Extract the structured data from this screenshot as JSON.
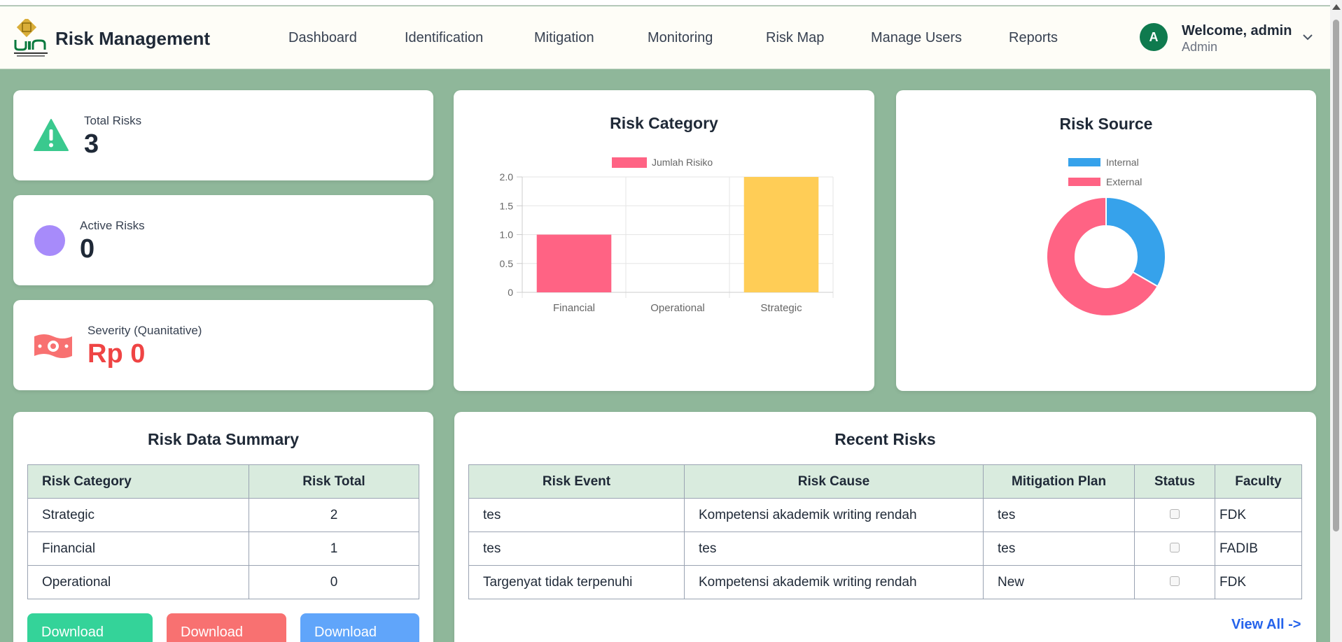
{
  "app": {
    "title": "Risk Management"
  },
  "nav": {
    "items": [
      {
        "label": "Dashboard"
      },
      {
        "label": "Identification"
      },
      {
        "label": "Mitigation"
      },
      {
        "label": "Monitoring"
      },
      {
        "label": "Risk Map"
      },
      {
        "label": "Manage Users"
      },
      {
        "label": "Reports"
      }
    ]
  },
  "user": {
    "avatar_letter": "A",
    "welcome": "Welcome, admin",
    "role": "Admin"
  },
  "stats": {
    "total": {
      "label": "Total Risks",
      "value": "3",
      "icon": "warning-icon"
    },
    "active": {
      "label": "Active Risks",
      "value": "0",
      "icon": "circle-icon"
    },
    "severity": {
      "label": "Severity (Quanitative)",
      "value": "Rp 0",
      "icon": "money-icon"
    }
  },
  "colors": {
    "accent_green": "#3ac98e",
    "purple": "#a78bfa",
    "red": "#ef4444",
    "pink": "#ff6384",
    "yellow": "#ffcd56",
    "blue": "#36a2eb"
  },
  "chart_data": [
    {
      "type": "bar",
      "title": "Risk Category",
      "categories": [
        "Financial",
        "Operational",
        "Strategic"
      ],
      "series": [
        {
          "name": "Jumlah Risiko",
          "values": [
            1,
            0,
            2
          ]
        }
      ],
      "bar_colors": [
        "#ff6384",
        "#36a2eb",
        "#ffcd56"
      ],
      "ylim": [
        0,
        2
      ],
      "yticks": [
        "2.0",
        "1.5",
        "1.0",
        "0.5",
        "0"
      ],
      "grid": true,
      "legend": "top"
    },
    {
      "type": "pie",
      "variant": "doughnut",
      "title": "Risk Source",
      "labels": [
        "Internal",
        "External"
      ],
      "values": [
        1,
        2
      ],
      "colors": [
        "#36a2eb",
        "#ff6384"
      ],
      "legend": "top"
    }
  ],
  "summary": {
    "title": "Risk Data Summary",
    "headers": [
      "Risk Category",
      "Risk Total"
    ],
    "rows": [
      [
        "Strategic",
        "2"
      ],
      [
        "Financial",
        "1"
      ],
      [
        "Operational",
        "0"
      ]
    ],
    "buttons": [
      "Download",
      "Download",
      "Download"
    ]
  },
  "recent": {
    "title": "Recent Risks",
    "headers": [
      "Risk Event",
      "Risk Cause",
      "Mitigation Plan",
      "Status",
      "Faculty"
    ],
    "rows": [
      [
        "tes",
        "Kompetensi akademik writing rendah",
        "tes",
        "",
        "FDK"
      ],
      [
        "tes",
        "tes",
        "tes",
        "",
        "FADIB"
      ],
      [
        "Targenyat tidak terpenuhi",
        "Kompetensi akademik writing rendah",
        "New",
        "",
        "FDK"
      ]
    ],
    "view_all": "View All ->"
  }
}
